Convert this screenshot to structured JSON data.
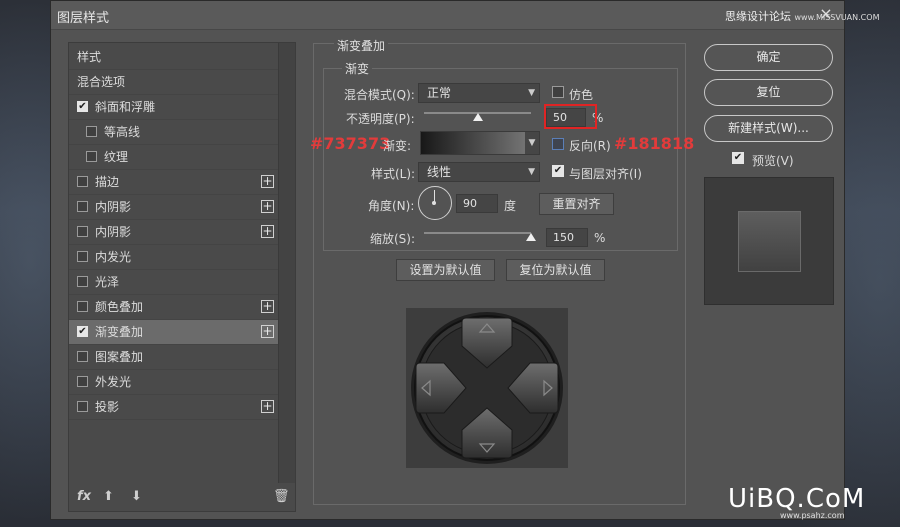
{
  "window": {
    "title": "图层样式",
    "close_label": "×",
    "watermark": "思缘设计论坛",
    "watermark_url": "www.MISSVUAN.COM"
  },
  "left_panel": {
    "items": [
      {
        "label": "样式",
        "checkbox": null,
        "plus": false,
        "indent": 0,
        "selected": false
      },
      {
        "label": "混合选项",
        "checkbox": null,
        "plus": false,
        "indent": 0,
        "selected": false
      },
      {
        "label": "斜面和浮雕",
        "checkbox": true,
        "plus": false,
        "indent": 0,
        "selected": false
      },
      {
        "label": "等高线",
        "checkbox": false,
        "plus": false,
        "indent": 1,
        "selected": false
      },
      {
        "label": "纹理",
        "checkbox": false,
        "plus": false,
        "indent": 1,
        "selected": false
      },
      {
        "label": "描边",
        "checkbox": false,
        "plus": true,
        "indent": 0,
        "selected": false
      },
      {
        "label": "内阴影",
        "checkbox": false,
        "plus": true,
        "indent": 0,
        "selected": false
      },
      {
        "label": "内阴影",
        "checkbox": false,
        "plus": true,
        "indent": 0,
        "selected": false
      },
      {
        "label": "内发光",
        "checkbox": false,
        "plus": false,
        "indent": 0,
        "selected": false
      },
      {
        "label": "光泽",
        "checkbox": false,
        "plus": false,
        "indent": 0,
        "selected": false
      },
      {
        "label": "颜色叠加",
        "checkbox": false,
        "plus": true,
        "indent": 0,
        "selected": false
      },
      {
        "label": "渐变叠加",
        "checkbox": true,
        "plus": true,
        "indent": 0,
        "selected": true
      },
      {
        "label": "图案叠加",
        "checkbox": false,
        "plus": false,
        "indent": 0,
        "selected": false
      },
      {
        "label": "外发光",
        "checkbox": false,
        "plus": false,
        "indent": 0,
        "selected": false
      },
      {
        "label": "投影",
        "checkbox": false,
        "plus": true,
        "indent": 0,
        "selected": false
      }
    ],
    "bottom_icons": [
      "fx-icon",
      "arrow-up-icon",
      "arrow-down-icon",
      "trash-icon"
    ]
  },
  "gradient_overlay": {
    "section_title": "渐变叠加",
    "group_title": "渐变",
    "blend_mode_label": "混合模式(Q):",
    "blend_mode_value": "正常",
    "dither_label": "仿色",
    "dither_checked": false,
    "opacity_label": "不透明度(P):",
    "opacity_value": "50",
    "opacity_unit": "%",
    "opacity_level": 0.5,
    "gradient_label": "渐变:",
    "gradient_start_color": "#737373",
    "gradient_end_color": "#181818",
    "reverse_label": "反向(R)",
    "reverse_checked": false,
    "style_label": "样式(L):",
    "style_value": "线性",
    "align_label": "与图层对齐(I)",
    "align_checked": true,
    "angle_label": "角度(N):",
    "angle_value": "90",
    "angle_unit": "度",
    "reset_align_label": "重置对齐",
    "scale_label": "缩放(S):",
    "scale_value": "150",
    "scale_unit": "%",
    "scale_level": 1.0,
    "set_default_label": "设置为默认值",
    "reset_default_label": "复位为默认值"
  },
  "annotations": {
    "left_color": "#737373",
    "right_color": "#181818"
  },
  "right_panel": {
    "ok_label": "确定",
    "reset_label": "复位",
    "new_style_label": "新建样式(W)...",
    "preview_label": "预览(V)",
    "preview_checked": true
  },
  "site_mark": {
    "text": "UiBQ.CoM",
    "sub": "www.psahz.com"
  }
}
